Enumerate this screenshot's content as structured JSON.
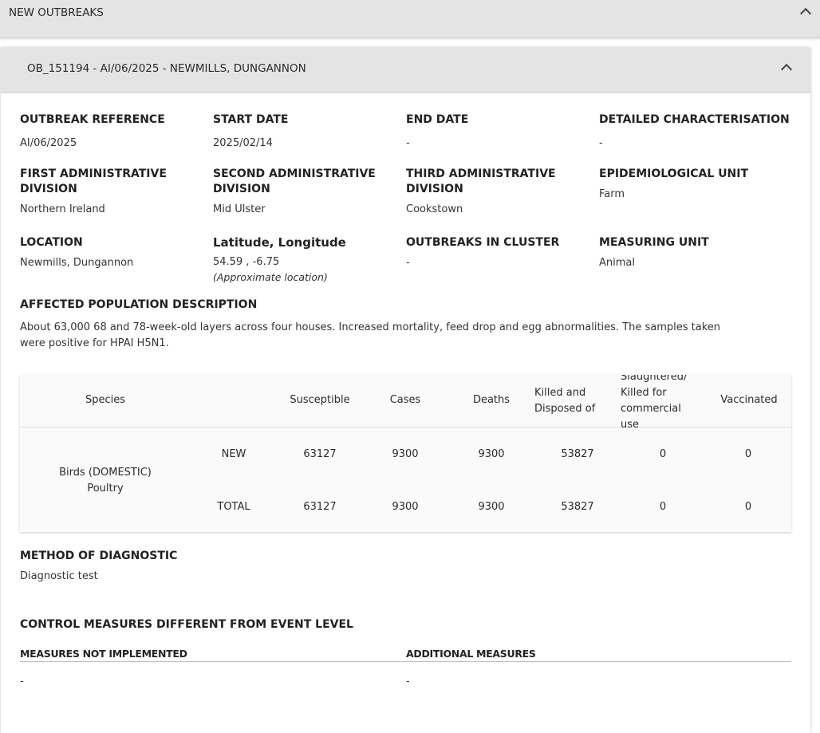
{
  "section": {
    "title": "NEW OUTBREAKS"
  },
  "outbreak": {
    "title": "OB_151194 - AI/06/2025 - NEWMILLS, DUNGANNON",
    "fields": {
      "outbreak_reference": {
        "label": "OUTBREAK REFERENCE",
        "value": "AI/06/2025"
      },
      "start_date": {
        "label": "START DATE",
        "value": "2025/02/14"
      },
      "end_date": {
        "label": "END DATE",
        "value": "-"
      },
      "detailed_characterisation": {
        "label": "DETAILED CHARACTERISATION",
        "value": "-"
      },
      "first_admin": {
        "label1": "FIRST ADMINISTRATIVE",
        "label2": "DIVISION",
        "value": "Northern Ireland"
      },
      "second_admin": {
        "label1": "SECOND ADMINISTRATIVE",
        "label2": "DIVISION",
        "value": "Mid Ulster"
      },
      "third_admin": {
        "label1": "THIRD ADMINISTRATIVE",
        "label2": "DIVISION",
        "value": "Cookstown"
      },
      "epi_unit": {
        "label": "EPIDEMIOLOGICAL UNIT",
        "value": "Farm"
      },
      "location": {
        "label": "LOCATION",
        "value": "Newmills, Dungannon"
      },
      "latlon": {
        "label": "Latitude, Longitude",
        "value": "54.59 , -6.75",
        "note": "(Approximate location)"
      },
      "cluster": {
        "label": "OUTBREAKS IN CLUSTER",
        "value": "-"
      },
      "measuring_unit": {
        "label": "MEASURING UNIT",
        "value": "Animal"
      }
    },
    "affected": {
      "label": "AFFECTED POPULATION DESCRIPTION",
      "line1": "About 63,000 68 and 78-week-old layers across four houses. Increased mortality, feed drop and egg abnormalities. The samples taken",
      "line2": "were positive for HPAI H5N1."
    },
    "table": {
      "headers": {
        "species": "Species",
        "susceptible": "Susceptible",
        "cases": "Cases",
        "deaths": "Deaths",
        "killed_1": "Killed and",
        "killed_2": "Disposed of",
        "slaughtered_1": "Slaughtered/",
        "slaughtered_2": "Killed for",
        "slaughtered_3": "commercial",
        "slaughtered_4": "use",
        "vaccinated": "Vaccinated"
      },
      "species_1": "Birds (DOMESTIC)",
      "species_2": "Poultry",
      "rows": [
        {
          "label": "NEW",
          "susceptible": "63127",
          "cases": "9300",
          "deaths": "9300",
          "killed": "53827",
          "slaughtered": "0",
          "vaccinated": "0"
        },
        {
          "label": "TOTAL",
          "susceptible": "63127",
          "cases": "9300",
          "deaths": "9300",
          "killed": "53827",
          "slaughtered": "0",
          "vaccinated": "0"
        }
      ]
    },
    "diagnostic": {
      "label": "METHOD OF DIAGNOSTIC",
      "value": "Diagnostic test"
    },
    "control": {
      "label": "CONTROL MEASURES DIFFERENT FROM EVENT LEVEL",
      "not_implemented": {
        "label": "MEASURES NOT IMPLEMENTED",
        "value": "-"
      },
      "additional": {
        "label": "ADDITIONAL MEASURES",
        "value": "-"
      }
    }
  }
}
